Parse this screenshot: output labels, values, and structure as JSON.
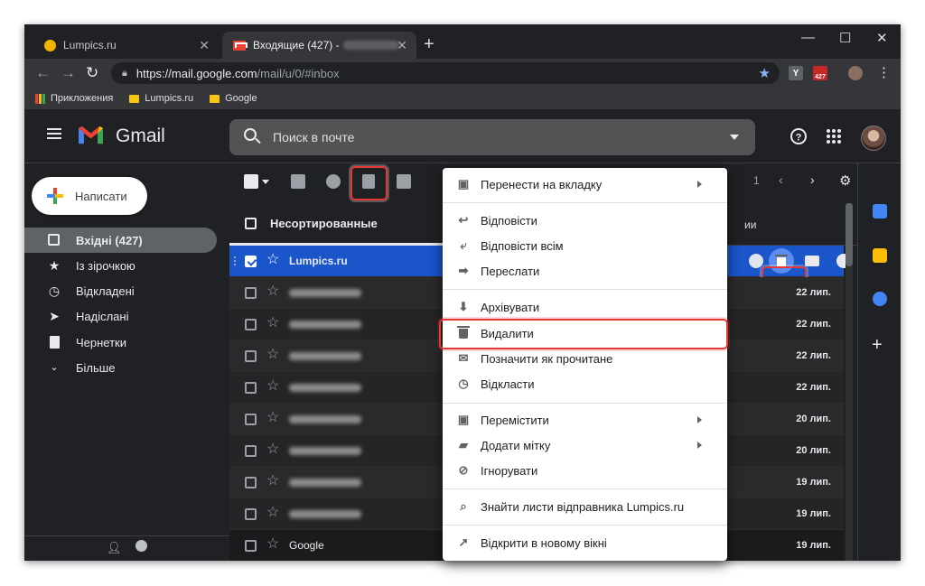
{
  "browser": {
    "tabs": [
      {
        "title": "Lumpics.ru"
      },
      {
        "title": "Входящие (427) -"
      }
    ],
    "url_host": "https://mail.google.com",
    "url_path": "/mail/u/0/#inbox",
    "bookmarks": [
      {
        "label": "Прикложения"
      },
      {
        "label": "Lumpics.ru"
      },
      {
        "label": "Google"
      }
    ],
    "ext_badge": "427"
  },
  "gmail": {
    "title": "Gmail",
    "search_placeholder": "Поиск в почте",
    "compose_label": "Написати",
    "nav": [
      {
        "label": "Вхідні (427)"
      },
      {
        "label": "Із зірочкою"
      },
      {
        "label": "Відкладені"
      },
      {
        "label": "Надіслані"
      },
      {
        "label": "Чернетки"
      },
      {
        "label": "Більше"
      }
    ],
    "category_tab": "Несортированные",
    "category_rest": "ии",
    "pagination": "1",
    "rows": [
      {
        "sender": "Lumpics.ru",
        "date": "",
        "selected": true
      },
      {
        "sender": "",
        "date": "22 лип."
      },
      {
        "sender": "",
        "date": "22 лип."
      },
      {
        "sender": "",
        "date": "22 лип."
      },
      {
        "sender": "",
        "date": "22 лип."
      },
      {
        "sender": "",
        "date": "20 лип."
      },
      {
        "sender": "",
        "date": "20 лип."
      },
      {
        "sender": "",
        "date": "19 лип."
      },
      {
        "sender": "",
        "date": "19 лип."
      },
      {
        "sender": "Google",
        "date": "19 лип."
      }
    ]
  },
  "context_menu": {
    "items": [
      {
        "label": "Перенести на вкладку",
        "submenu": true
      },
      {
        "label": "Відповісти"
      },
      {
        "label": "Відповісти всім"
      },
      {
        "label": "Переслати"
      },
      {
        "label": "Архівувати"
      },
      {
        "label": "Видалити",
        "highlighted": true
      },
      {
        "label": "Позначити як прочитане"
      },
      {
        "label": "Відкласти"
      },
      {
        "label": "Перемістити",
        "submenu": true
      },
      {
        "label": "Додати мітку",
        "submenu": true
      },
      {
        "label": "Ігнорувати"
      },
      {
        "label": "Знайти листи відправника Lumpics.ru"
      },
      {
        "label": "Відкрити в новому вікні"
      }
    ]
  },
  "colors": {
    "highlight": "#e53935",
    "selected_row": "#1a55c9",
    "dark_bg": "#202124"
  }
}
